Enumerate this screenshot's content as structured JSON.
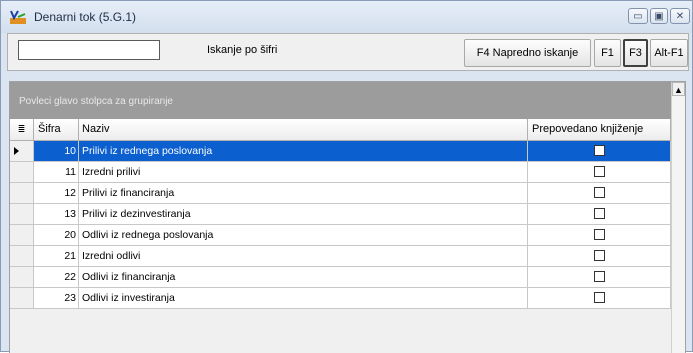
{
  "window": {
    "title": "Denarni tok  (5.G.1)",
    "icon": "app-logo-icon",
    "controls": [
      "minimize-icon",
      "maximize-icon",
      "close-icon"
    ]
  },
  "toolbar": {
    "search_value": "",
    "search_label": "Iskanje po šifri",
    "advanced_search_label": "F4  Napredno iskanje",
    "f1_label": "F1",
    "f3_label": "F3",
    "altf1_label": "Alt-F1"
  },
  "grid": {
    "group_hint": "Povleci glavo stolpca za grupiranje",
    "columns": [
      "Šifra",
      "Naziv",
      "Prepovedano knjiženje"
    ],
    "rows": [
      {
        "code": "10",
        "name": "Prilivi iz rednega poslovanja",
        "forbidden": false,
        "selected": true
      },
      {
        "code": "11",
        "name": "Izredni prilivi",
        "forbidden": false,
        "selected": false
      },
      {
        "code": "12",
        "name": "Prilivi iz financiranja",
        "forbidden": false,
        "selected": false
      },
      {
        "code": "13",
        "name": "Prilivi iz dezinvestiranja",
        "forbidden": false,
        "selected": false
      },
      {
        "code": "20",
        "name": "Odlivi iz rednega poslovanja",
        "forbidden": false,
        "selected": false
      },
      {
        "code": "21",
        "name": "Izredni odlivi",
        "forbidden": false,
        "selected": false
      },
      {
        "code": "22",
        "name": "Odlivi iz financiranja",
        "forbidden": false,
        "selected": false
      },
      {
        "code": "23",
        "name": "Odlivi iz investiranja",
        "forbidden": false,
        "selected": false
      }
    ]
  },
  "colors": {
    "selection": "#0b5fcf",
    "group_bar": "#9c9c9c",
    "titlebar": "#dbe5f1"
  }
}
